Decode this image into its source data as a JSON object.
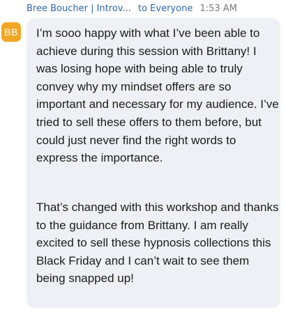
{
  "message": {
    "sender": "Bree Boucher | Introv...",
    "recipient": "to Everyone",
    "time": "1:53 AM",
    "avatar_initials": "BB",
    "avatar_color": "#f2a623",
    "paragraphs": [
      "I’m sooo happy with what I’ve been able to achieve during this session with Brittany! I was losing hope with being able to truly convey why my mindset offers are so important and necessary for my audience. I’ve tried to sell these offers to them before, but could just never find the right words to express the importance.",
      "That’s changed with this workshop and thanks to the guidance from Brittany. I am really excited to sell these hypnosis collections this Black Friday and I can’t wait to see them being snapped up!"
    ]
  }
}
